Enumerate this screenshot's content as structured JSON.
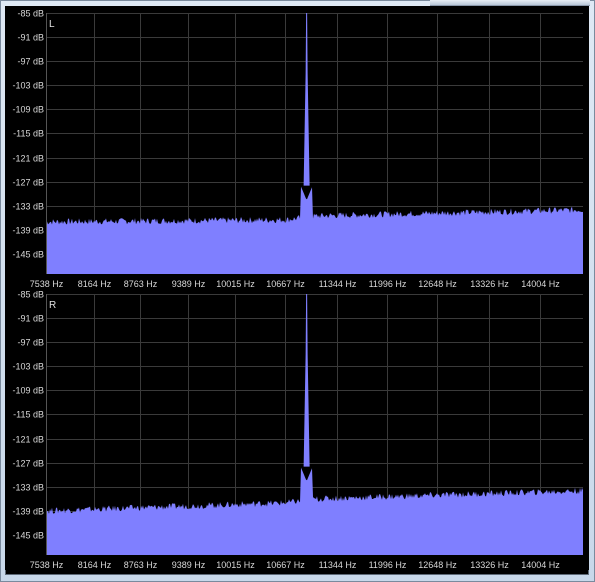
{
  "chart_data": [
    {
      "type": "area",
      "channel": "L",
      "y_tick_labels": [
        "-85 dB",
        "-91 dB",
        "-97 dB",
        "-103 dB",
        "-109 dB",
        "-115 dB",
        "-121 dB",
        "-127 dB",
        "-133 dB",
        "-139 dB",
        "-145 dB"
      ],
      "y_ticks": [
        -85,
        -91,
        -97,
        -103,
        -109,
        -115,
        -121,
        -127,
        -133,
        -139,
        -145
      ],
      "x_tick_labels": [
        "7538 Hz",
        "8164 Hz",
        "8763 Hz",
        "9389 Hz",
        "10015 Hz",
        "10667 Hz",
        "11344 Hz",
        "11996 Hz",
        "12648 Hz",
        "13326 Hz",
        "14004 Hz"
      ],
      "x_ticks": [
        7538,
        8164,
        8763,
        9389,
        10015,
        10667,
        11344,
        11996,
        12648,
        13326,
        14004
      ],
      "xlim": [
        7538,
        14562
      ],
      "ylim": [
        -85,
        -150
      ],
      "color": "#7f7fff",
      "grid": true,
      "noise_floor": {
        "x": [
          7538,
          10667,
          11100,
          14562
        ],
        "y": [
          -137,
          -136.5,
          -135.5,
          -134
        ]
      },
      "peak": {
        "x": 10947,
        "y": -85
      },
      "peak_shoulder": {
        "y": -100
      },
      "peak_base": {
        "y": -128
      }
    },
    {
      "type": "area",
      "channel": "R",
      "y_tick_labels": [
        "-85 dB",
        "-91 dB",
        "-97 dB",
        "-103 dB",
        "-109 dB",
        "-115 dB",
        "-121 dB",
        "-127 dB",
        "-133 dB",
        "-139 dB",
        "-145 dB"
      ],
      "y_ticks": [
        -85,
        -91,
        -97,
        -103,
        -109,
        -115,
        -121,
        -127,
        -133,
        -139,
        -145
      ],
      "x_tick_labels": [
        "7538 Hz",
        "8164 Hz",
        "8763 Hz",
        "9389 Hz",
        "10015 Hz",
        "10667 Hz",
        "11344 Hz",
        "11996 Hz",
        "12648 Hz",
        "13326 Hz",
        "14004 Hz"
      ],
      "x_ticks": [
        7538,
        8164,
        8763,
        9389,
        10015,
        10667,
        11344,
        11996,
        12648,
        13326,
        14004
      ],
      "xlim": [
        7538,
        14562
      ],
      "ylim": [
        -85,
        -150
      ],
      "color": "#7f7fff",
      "grid": true,
      "noise_floor": {
        "x": [
          7538,
          10667,
          11100,
          14562
        ],
        "y": [
          -139,
          -137,
          -136,
          -134
        ]
      },
      "peak": {
        "x": 10947,
        "y": -85
      },
      "peak_shoulder": {
        "y": -100
      },
      "peak_base": {
        "y": -128
      }
    }
  ]
}
